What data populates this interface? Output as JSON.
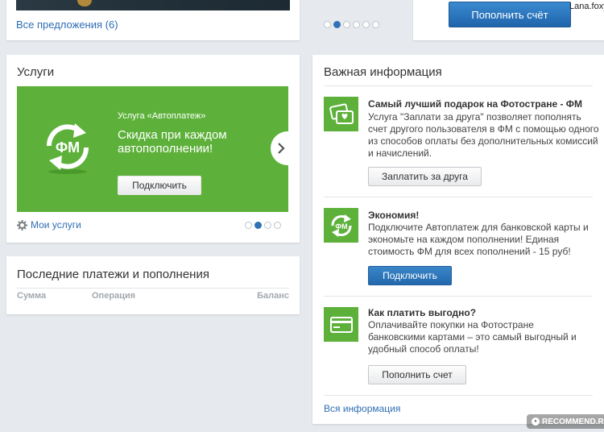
{
  "offers": {
    "link": "Все предложения (6)",
    "dots": [
      false,
      true,
      false,
      false,
      false,
      false
    ]
  },
  "topup": {
    "button": "Пополнить счёт",
    "user": "Lana.foxy"
  },
  "services": {
    "title": "Услуги",
    "banner": {
      "subtitle": "Услуга «Автоплатеж»",
      "headline": "Скидка при каждом автопополнении!",
      "button": "Подключить",
      "logo_text": "ФМ",
      "bg_color": "#5db13a"
    },
    "my_services": "Мои услуги",
    "dots": [
      false,
      true,
      false,
      false
    ]
  },
  "payments": {
    "title": "Последние платежи и пополнения",
    "columns": [
      "Сумма",
      "Операция",
      "Баланс"
    ]
  },
  "info": {
    "title": "Важная информация",
    "items": [
      {
        "icon": "gift-card-icon",
        "title": "Самый лучший подарок на Фотостране - ФМ",
        "text": "Услуга \"Заплати за друга\" позволяет пополнять счет другого пользователя в ФМ с помощью одного из способов оплаты без дополнительных комиссий и начислений.",
        "button": "Заплатить за друга",
        "button_style": "gray"
      },
      {
        "icon": "fm-refresh-icon",
        "icon_text": "ФМ",
        "title": "Экономия!",
        "text": "Подключите Автоплатеж для банковской карты и экономьте на каждом пополнении! Единая стоимость ФМ для всех пополнений - 15 руб!",
        "button": "Подключить",
        "button_style": "blue"
      },
      {
        "icon": "credit-card-icon",
        "title": "Как платить выгодно?",
        "text": "Оплачивайте покупки на Фотостране банковскими картами – это самый выгодный и удобный способ оплаты!",
        "button": "Пополнить счет",
        "button_style": "gray"
      }
    ],
    "all_link": "Вся информация"
  },
  "watermark": "RECOMMEND.RU"
}
